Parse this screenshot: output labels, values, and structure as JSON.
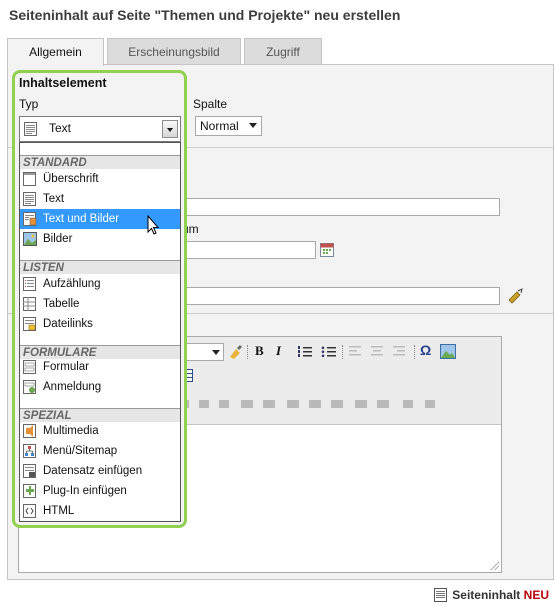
{
  "title": "Seiteninhalt auf Seite \"Themen und Projekte\" neu erstellen",
  "tabs": [
    {
      "label": "Allgemein",
      "active": true
    },
    {
      "label": "Erscheinungsbild",
      "active": false
    },
    {
      "label": "Zugriff",
      "active": false
    }
  ],
  "form": {
    "section_label": "Inhaltselement",
    "type_label": "Typ",
    "type_value": "Text",
    "column_label": "Spalte",
    "column_value": "Normal",
    "partial_label_um": "um"
  },
  "dropdown": {
    "groups": [
      {
        "label": "STANDARD",
        "items": [
          {
            "label": "Überschrift",
            "icon": "heading-icon"
          },
          {
            "label": "Text",
            "icon": "text-icon"
          },
          {
            "label": "Text und Bilder",
            "icon": "text-image-icon",
            "selected": true
          },
          {
            "label": "Bilder",
            "icon": "images-icon"
          }
        ]
      },
      {
        "label": "LISTEN",
        "items": [
          {
            "label": "Aufzählung",
            "icon": "bullet-list-icon"
          },
          {
            "label": "Tabelle",
            "icon": "table-icon"
          },
          {
            "label": "Dateilinks",
            "icon": "file-links-icon"
          }
        ]
      },
      {
        "label": "FORMULARE",
        "items": [
          {
            "label": "Formular",
            "icon": "form-icon"
          },
          {
            "label": "Anmeldung",
            "icon": "login-icon"
          }
        ]
      },
      {
        "label": "SPEZIAL",
        "items": [
          {
            "label": "Multimedia",
            "icon": "multimedia-icon"
          },
          {
            "label": "Menü/Sitemap",
            "icon": "sitemap-icon"
          },
          {
            "label": "Datensatz einfügen",
            "icon": "insert-record-icon"
          },
          {
            "label": "Plug-In einfügen",
            "icon": "plugin-icon"
          },
          {
            "label": "HTML",
            "icon": "html-icon"
          }
        ]
      }
    ]
  },
  "footer": {
    "label": "Seiteninhalt",
    "badge": "NEU"
  },
  "colors": {
    "highlight": "#92d050",
    "selected": "#3399ff",
    "neu": "#b8000c"
  }
}
